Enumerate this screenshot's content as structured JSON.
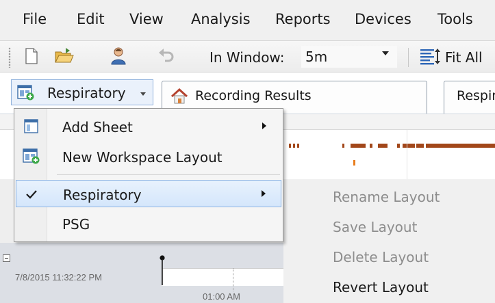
{
  "menubar": {
    "items": [
      "File",
      "Edit",
      "View",
      "Analysis",
      "Reports",
      "Devices",
      "Tools"
    ]
  },
  "toolbar": {
    "new_icon": "new-document-icon",
    "open_icon": "open-folder-icon",
    "user_icon": "user-icon",
    "undo_icon": "undo-icon",
    "in_window_label": "In Window:",
    "in_window_value": "5m",
    "fit_all_label": "Fit All",
    "fit_all_icon": "fit-all-icon"
  },
  "layout_selector": {
    "label": "Respiratory",
    "icon": "workspace-layout-icon"
  },
  "tabs": [
    {
      "label": "Recording Results",
      "icon": "home-icon"
    },
    {
      "label": "Respir"
    }
  ],
  "layout_menu": {
    "items": [
      {
        "label": "Add Sheet",
        "icon": "sheet-icon",
        "has_submenu": true
      },
      {
        "label": "New Workspace Layout",
        "icon": "new-layout-icon",
        "has_submenu": false
      },
      {
        "label": "Respiratory",
        "icon": "checkmark-icon",
        "has_submenu": true,
        "checked": true,
        "highlighted": true
      },
      {
        "label": "PSG",
        "has_submenu": false
      }
    ]
  },
  "layout_submenu": {
    "items": [
      {
        "label": "Rename Layout",
        "enabled": false
      },
      {
        "label": "Save Layout",
        "enabled": false
      },
      {
        "label": "Delete Layout",
        "enabled": false
      },
      {
        "label": "Revert Layout",
        "enabled": true
      }
    ]
  },
  "timeline": {
    "start_datetime": "7/8/2015 11:32:22 PM",
    "tick_label": "01:00 AM"
  },
  "colors": {
    "event_marker": "#a2471a",
    "event_marker_orange": "#e87d1e",
    "highlight": "#d4e6fb"
  }
}
